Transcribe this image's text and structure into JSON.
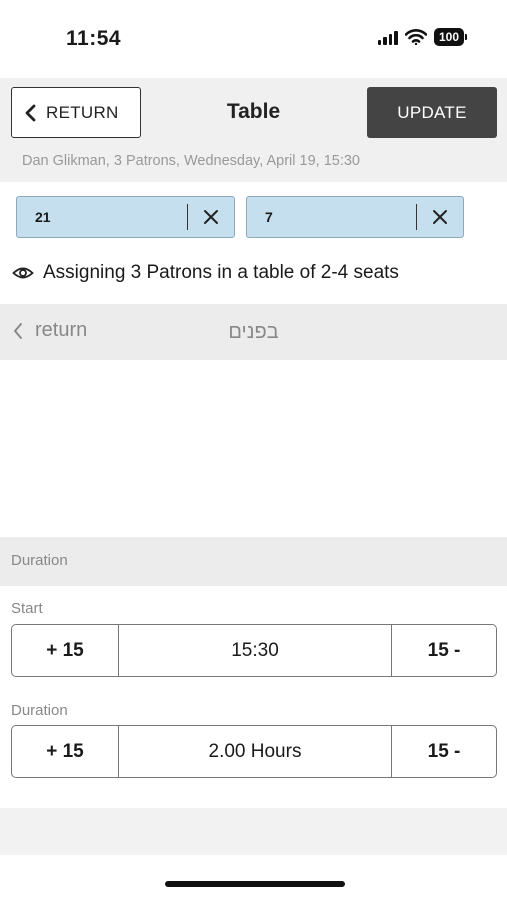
{
  "status": {
    "time": "11:54",
    "battery": "100"
  },
  "header": {
    "return_label": "RETURN",
    "title": "Table",
    "update_label": "UPDATE",
    "subtitle": "Dan Glikman, 3 Patrons, Wednesday, April 19, 15:30"
  },
  "chips": [
    {
      "value": "21"
    },
    {
      "value": "7"
    }
  ],
  "assign_text": "Assigning 3 Patrons in a table of 2-4 seats",
  "nav": {
    "back_label": "return",
    "area_label": "בפנים"
  },
  "duration_section_label": "Duration",
  "start": {
    "label": "Start",
    "plus_label": "+ 15",
    "value": "15:30",
    "minus_label": "15 -"
  },
  "duration": {
    "label": "Duration",
    "plus_label": "+ 15",
    "value": "2.00 Hours",
    "minus_label": "15 -"
  },
  "icons": {
    "back": "chevron-left-icon",
    "remove": "close-icon",
    "view": "eye-icon"
  }
}
